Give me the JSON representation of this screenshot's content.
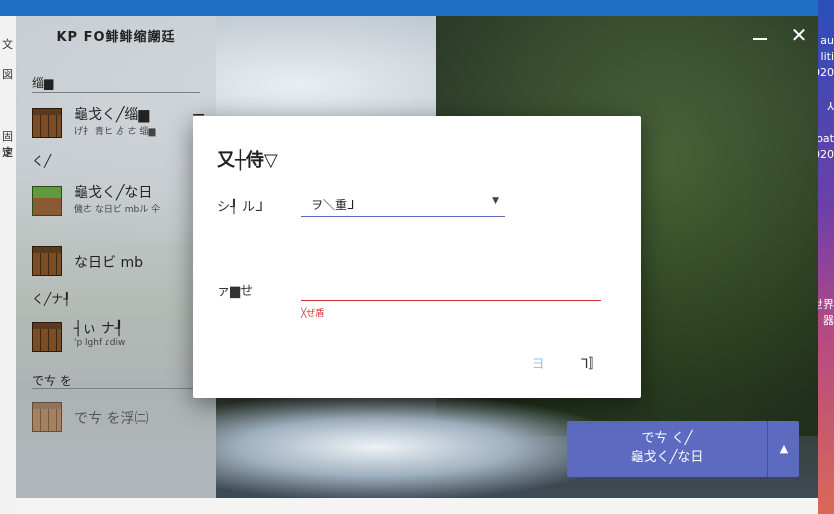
{
  "desktop": {
    "right_texts": [
      "au",
      "liti",
      "020",
      "⅄",
      "oat",
      "020",
      "世界",
      "器"
    ],
    "left_texts": [
      "文",
      "図",
      "固定",
      "速"
    ]
  },
  "window": {
    "title": "KP FO鲱鲱缩謿廷",
    "minimize_icon": "minimize-icon",
    "close_icon": "close-icon",
    "close_glyph": "✕"
  },
  "sidebar": {
    "section_head_1": "缁▆",
    "section_head_2": "く╱",
    "section_head_3": "く╱ナ┦",
    "section_head_4": "でㄘ を",
    "items": [
      {
        "name": "龜戈く╱缁▆",
        "sub": "げ扌 青ヒ ゟ ㄜ 缁▆"
      },
      {
        "name": "龜戈く╱な日",
        "sub": "僟ㄜ な日ビ mbル 仐"
      },
      {
        "name": "な日ビ mb",
        "sub": ""
      },
      {
        "name": "┤ぃ ナ┦",
        "sub": "'p lghf ɾdiw"
      },
      {
        "name": "でㄘ を浮㈡",
        "sub": ""
      }
    ],
    "menu_glyph": "☰"
  },
  "dialog": {
    "title": "又┼侍▽",
    "field1_label": "シ┦ ルᒧ",
    "field1_value": "ヲ＼重ᒧ",
    "field1_caret": "▼",
    "field2_label": "ァ▆せ",
    "field2_value": "",
    "field2_placeholder": "",
    "error": "╳ぜ盾",
    "cancel_label": "ヨ",
    "ok_label": "ᒣ〛"
  },
  "play": {
    "line1": "でㄘ く╱",
    "line2": "龜戈く╱な日",
    "arrow": "▲"
  }
}
